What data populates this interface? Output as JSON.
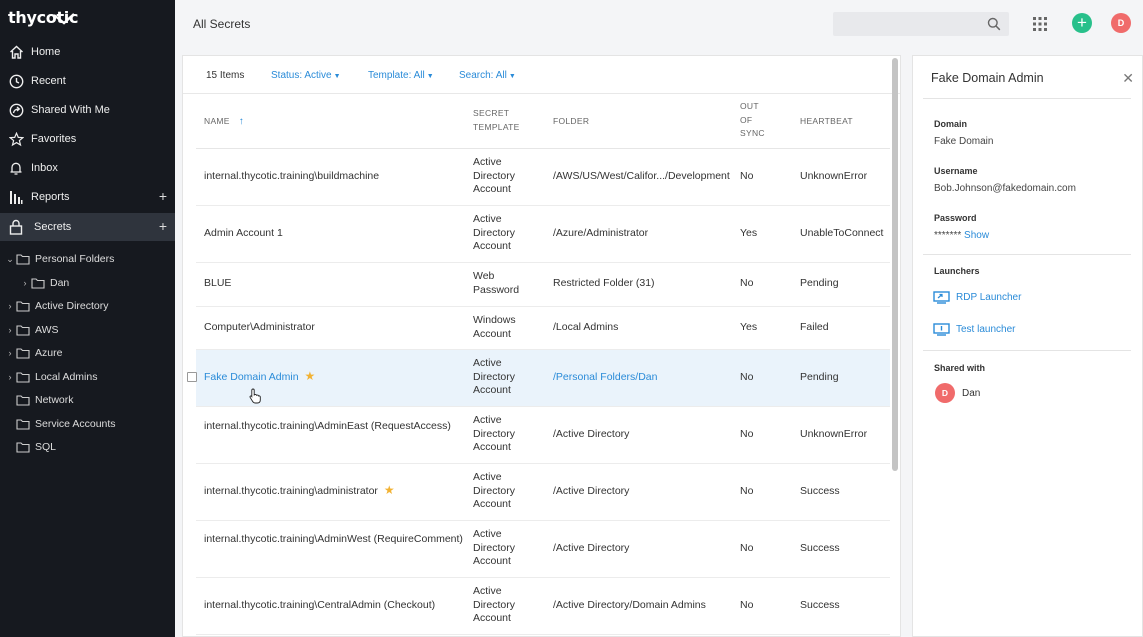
{
  "sidebar": {
    "logo": "thycotic",
    "nav": [
      {
        "label": "Home",
        "icon": "home-icon"
      },
      {
        "label": "Recent",
        "icon": "clock-icon"
      },
      {
        "label": "Shared With Me",
        "icon": "share-icon"
      },
      {
        "label": "Favorites",
        "icon": "star-icon"
      },
      {
        "label": "Inbox",
        "icon": "bell-icon"
      },
      {
        "label": "Reports",
        "icon": "bar-chart-icon"
      },
      {
        "label": "Secrets",
        "icon": "lock-icon"
      }
    ],
    "tree": [
      {
        "label": "Personal Folders"
      },
      {
        "label": "Dan"
      },
      {
        "label": "Active Directory"
      },
      {
        "label": "AWS"
      },
      {
        "label": "Azure"
      },
      {
        "label": "Local Admins"
      },
      {
        "label": "Network"
      },
      {
        "label": "Service Accounts"
      },
      {
        "label": "SQL"
      }
    ]
  },
  "header": {
    "title": "All Secrets",
    "search_placeholder": "",
    "avatar_initial": "D"
  },
  "toolbar": {
    "count": "15 Items",
    "status_filter": "Status: Active",
    "template_filter": "Template: All",
    "search_filter": "Search: All"
  },
  "table": {
    "headers": {
      "name": "NAME",
      "template_1": "SECRET",
      "template_2": "TEMPLATE",
      "folder": "FOLDER",
      "sync_1": "OUT",
      "sync_2": "OF",
      "sync_3": "SYNC",
      "heartbeat": "HEARTBEAT"
    },
    "rows": [
      {
        "name": "internal.thycotic.training\\buildmachine",
        "t1": "Active",
        "t2": "Directory",
        "t3": "Account",
        "folder": "/AWS/US/West/Califor.../Development",
        "sync": "No",
        "hb": "UnknownError"
      },
      {
        "name": "Admin Account 1",
        "t1": "Active",
        "t2": "Directory",
        "t3": "Account",
        "folder": "/Azure/Administrator",
        "sync": "Yes",
        "hb": "UnableToConnect"
      },
      {
        "name": "BLUE",
        "t1": "Web",
        "t2": "Password",
        "t3": "",
        "folder": "Restricted Folder (31)",
        "sync": "No",
        "hb": "Pending"
      },
      {
        "name": "Computer\\Administrator",
        "t1": "Windows",
        "t2": "Account",
        "t3": "",
        "folder": "/Local Admins",
        "sync": "Yes",
        "hb": "Failed"
      },
      {
        "name": "Fake Domain Admin",
        "t1": "Active",
        "t2": "Directory",
        "t3": "Account",
        "folder": "/Personal Folders/Dan",
        "sync": "No",
        "hb": "Pending"
      },
      {
        "name": "internal.thycotic.training\\AdminEast (RequestAccess)",
        "t1": "Active",
        "t2": "Directory",
        "t3": "Account",
        "folder": "/Active Directory",
        "sync": "No",
        "hb": "UnknownError"
      },
      {
        "name": "internal.thycotic.training\\administrator",
        "t1": "Active",
        "t2": "Directory",
        "t3": "Account",
        "folder": "/Active Directory",
        "sync": "No",
        "hb": "Success"
      },
      {
        "name": "internal.thycotic.training\\AdminWest (RequireComment)",
        "t1": "Active",
        "t2": "Directory",
        "t3": "Account",
        "folder": "/Active Directory",
        "sync": "No",
        "hb": "Success"
      },
      {
        "name": "internal.thycotic.training\\CentralAdmin (Checkout)",
        "t1": "Active",
        "t2": "Directory",
        "t3": "Account",
        "folder": "/Active Directory/Domain Admins",
        "sync": "No",
        "hb": "Success"
      }
    ]
  },
  "panel": {
    "title": "Fake Domain Admin",
    "domain_label": "Domain",
    "domain_value": "Fake Domain",
    "username_label": "Username",
    "username_value": "Bob.Johnson@fakedomain.com",
    "password_label": "Password",
    "password_mask": "*******",
    "show_label": "Show",
    "launchers_label": "Launchers",
    "launchers": [
      "RDP Launcher",
      "Test launcher"
    ],
    "shared_label": "Shared with",
    "shared_user": "Dan",
    "shared_initial": "D"
  },
  "colors": {
    "sidebar_bg": "#16191f",
    "accent_blue": "#2a8bd8",
    "add_green": "#28c08b",
    "avatar_red": "#f06b6b",
    "favorite_star": "#f2b233"
  }
}
